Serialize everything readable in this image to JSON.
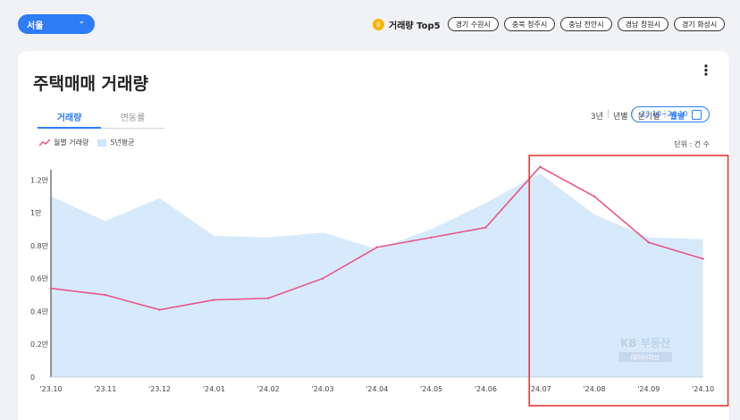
{
  "region_select": {
    "label": "서울",
    "icon": "chevron-down-icon"
  },
  "top5": {
    "title": "거래량 Top5",
    "icon": "crown-icon",
    "chips": [
      "경기 수원시",
      "충북 청주시",
      "충남 천안시",
      "경남 창원시",
      "경기 화성시"
    ]
  },
  "card": {
    "title": "주택매매 거래량",
    "tabs": [
      {
        "label": "거래량",
        "active": true
      },
      {
        "label": "변동률",
        "active": false
      }
    ],
    "periods": [
      {
        "label": "3년",
        "active": false
      },
      {
        "label": "년별",
        "active": false
      },
      {
        "label": "분기별",
        "active": false
      },
      {
        "label": "월별",
        "active": true
      }
    ],
    "range_label": "23.10~24.10",
    "unit": "단위 : 건 수",
    "legend": {
      "line": "월별 거래량",
      "area": "5년평균"
    },
    "watermark": {
      "line1": "KB 부동산",
      "line2": "데이터허브"
    }
  },
  "chart_data": {
    "type": "line",
    "categories": [
      "'23.10",
      "'23.11",
      "'23.12",
      "'24.01",
      "'24.02",
      "'24.03",
      "'24.04",
      "'24.05",
      "'24.06",
      "'24.07",
      "'24.08",
      "'24.09",
      "'24.10"
    ],
    "series": [
      {
        "name": "월별 거래량",
        "kind": "line",
        "color": "#e8578a",
        "values": [
          5400,
          5000,
          4100,
          4700,
          4800,
          6000,
          7900,
          8500,
          9100,
          12800,
          11000,
          8200,
          7200
        ]
      },
      {
        "name": "5년평균",
        "kind": "area",
        "color": "#d6eafb",
        "values": [
          11000,
          9500,
          10900,
          8600,
          8500,
          8800,
          7800,
          9000,
          10600,
          12400,
          9900,
          8500,
          8400
        ]
      }
    ],
    "ylim": [
      0,
      13000
    ],
    "yticks": [
      {
        "value": 0,
        "label": "0"
      },
      {
        "value": 2000,
        "label": "0.2만"
      },
      {
        "value": 4000,
        "label": "0.4만"
      },
      {
        "value": 6000,
        "label": "0.6만"
      },
      {
        "value": 8000,
        "label": "0.8만"
      },
      {
        "value": 10000,
        "label": "1만"
      },
      {
        "value": 12000,
        "label": "1.2만"
      }
    ],
    "highlight": {
      "from": "'24.07",
      "to": "'24.10",
      "color": "#e53935"
    }
  }
}
